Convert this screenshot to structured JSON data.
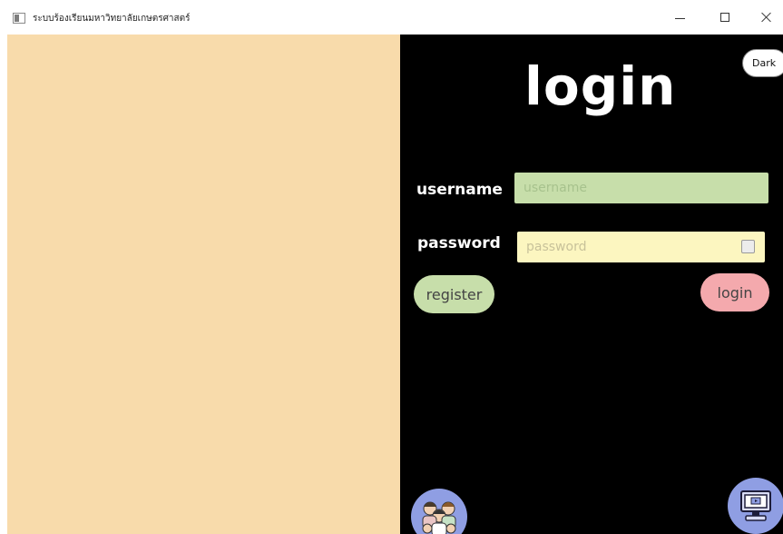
{
  "window": {
    "title": "ระบบร้องเรียนมหาวิทยาลัยเกษตรศาสตร์"
  },
  "theme_toggle": {
    "label": "Dark"
  },
  "login_form": {
    "title": "login",
    "username_label": "username",
    "username_placeholder": "username",
    "password_label": "password",
    "password_placeholder": "password",
    "register_label": "register",
    "login_label": "login"
  },
  "icons": {
    "app": "app-window-icon",
    "minimize": "minimize-icon",
    "maximize": "maximize-icon",
    "close": "close-icon",
    "people": "people-group-icon",
    "monitor": "monitor-icon"
  },
  "colors": {
    "left_panel": "#f8dbab",
    "right_panel": "#000000",
    "username_field": "#c7deaa",
    "password_field": "#fcf6c0",
    "register_button": "#c7deaa",
    "login_button": "#f4a9ad",
    "icon_circle": "#8f9ee3"
  }
}
